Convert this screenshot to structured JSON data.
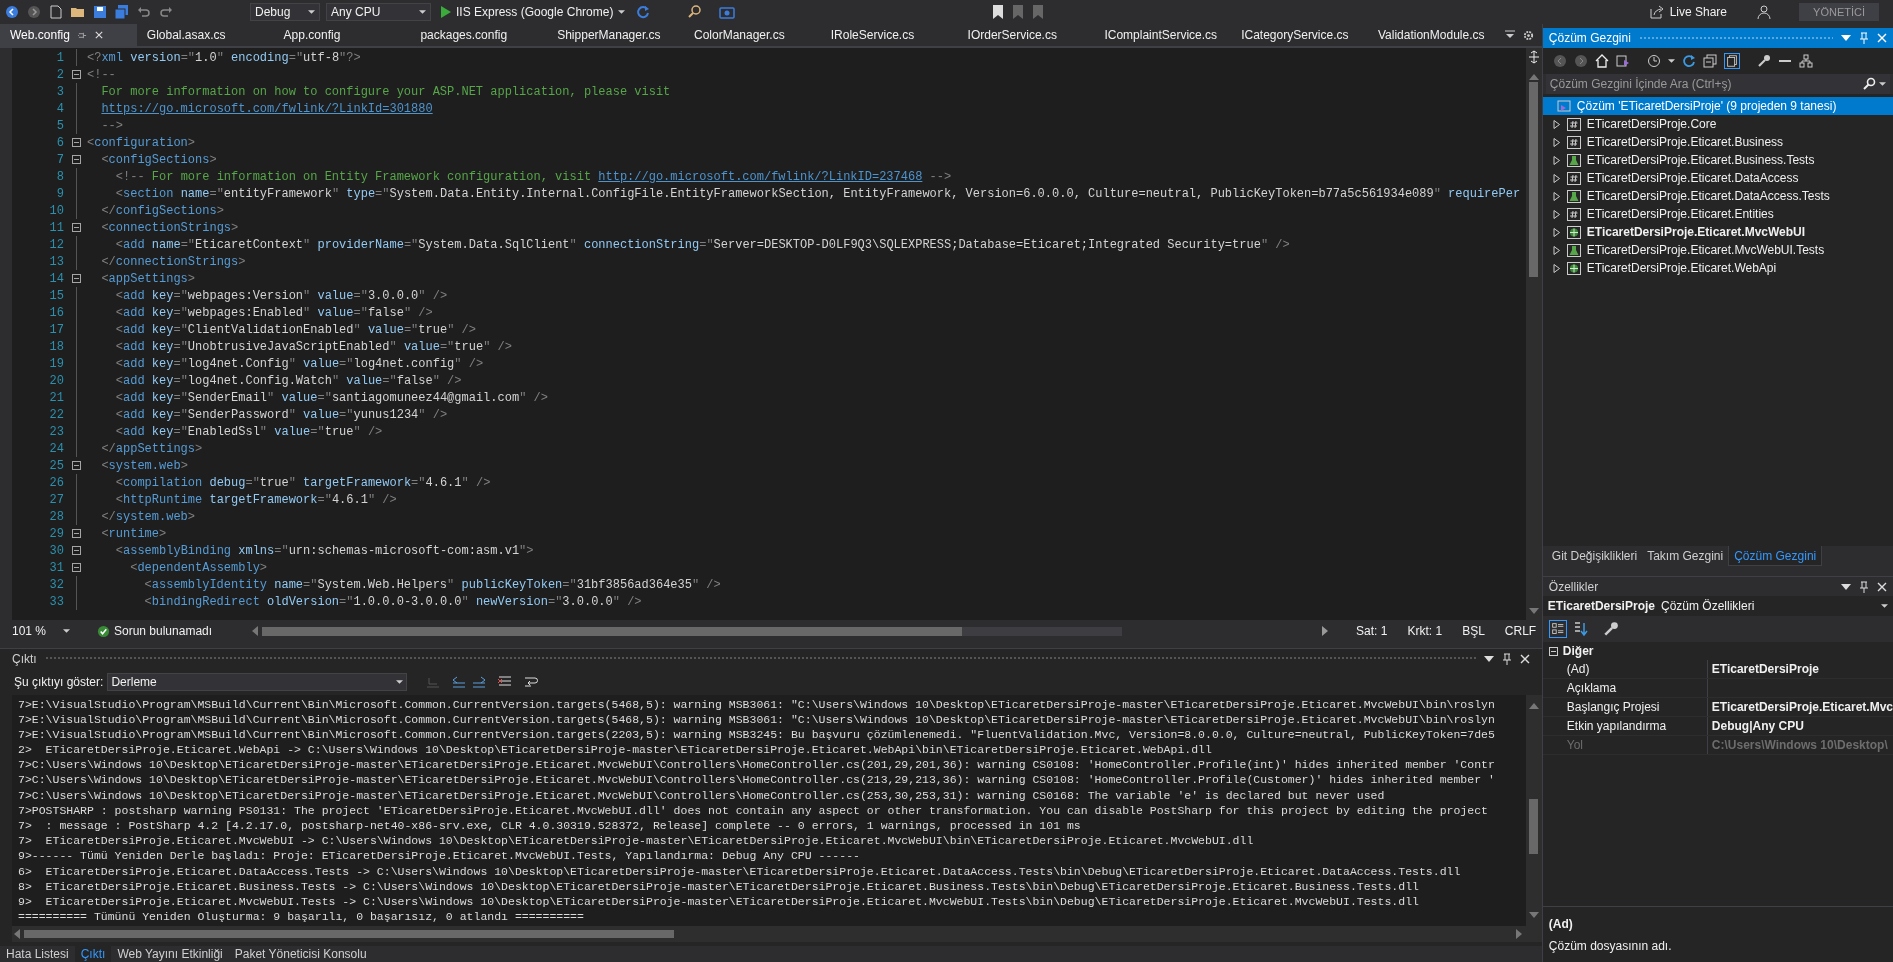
{
  "toolbar": {
    "configuration": "Debug",
    "platform": "Any CPU",
    "run_target": "IIS Express (Google Chrome)",
    "live_share": "Live Share",
    "user_badge": "YÖNETİCİ"
  },
  "tabs": [
    {
      "label": "Web.config",
      "selected": true
    },
    {
      "label": "Global.asax.cs",
      "selected": false
    },
    {
      "label": "App.config",
      "selected": false
    },
    {
      "label": "packages.config",
      "selected": false
    },
    {
      "label": "ShipperManager.cs",
      "selected": false
    },
    {
      "label": "ColorManager.cs",
      "selected": false
    },
    {
      "label": "IRoleService.cs",
      "selected": false
    },
    {
      "label": "IOrderService.cs",
      "selected": false
    },
    {
      "label": "IComplaintService.cs",
      "selected": false
    },
    {
      "label": "ICategoryService.cs",
      "selected": false
    },
    {
      "label": "ValidationModule.cs",
      "selected": false
    }
  ],
  "editor": {
    "lines": [
      {
        "number": "1",
        "text": "<?xml version=\"1.0\" encoding=\"utf-8\"?>",
        "fold": false
      },
      {
        "number": "2",
        "text": "<!--",
        "fold": true
      },
      {
        "number": "3",
        "text": "  For more information on how to configure your ASP.NET application, please visit",
        "fold": false
      },
      {
        "number": "4",
        "text": "  https://go.microsoft.com/fwlink/?LinkId=301880",
        "fold": false
      },
      {
        "number": "5",
        "text": "  -->",
        "fold": false
      },
      {
        "number": "6",
        "text": "<configuration>",
        "fold": true
      },
      {
        "number": "7",
        "text": "  <configSections>",
        "fold": true
      },
      {
        "number": "8",
        "text": "    <!-- For more information on Entity Framework configuration, visit http://go.microsoft.com/fwlink/?LinkID=237468 -->",
        "fold": false
      },
      {
        "number": "9",
        "text": "    <section name=\"entityFramework\" type=\"System.Data.Entity.Internal.ConfigFile.EntityFrameworkSection, EntityFramework, Version=6.0.0.0, Culture=neutral, PublicKeyToken=b77a5c561934e089\" requirePer",
        "fold": false
      },
      {
        "number": "10",
        "text": "  </configSections>",
        "fold": false
      },
      {
        "number": "11",
        "text": "  <connectionStrings>",
        "fold": true
      },
      {
        "number": "12",
        "text": "    <add name=\"EticaretContext\" providerName=\"System.Data.SqlClient\" connectionString=\"Server=DESKTOP-D0LF9Q3\\SQLEXPRESS;Database=Eticaret;Integrated Security=true\" />",
        "fold": false
      },
      {
        "number": "13",
        "text": "  </connectionStrings>",
        "fold": false
      },
      {
        "number": "14",
        "text": "  <appSettings>",
        "fold": true
      },
      {
        "number": "15",
        "text": "    <add key=\"webpages:Version\" value=\"3.0.0.0\" />",
        "fold": false
      },
      {
        "number": "16",
        "text": "    <add key=\"webpages:Enabled\" value=\"false\" />",
        "fold": false
      },
      {
        "number": "17",
        "text": "    <add key=\"ClientValidationEnabled\" value=\"true\" />",
        "fold": false
      },
      {
        "number": "18",
        "text": "    <add key=\"UnobtrusiveJavaScriptEnabled\" value=\"true\" />",
        "fold": false
      },
      {
        "number": "19",
        "text": "    <add key=\"log4net.Config\" value=\"log4net.config\" />",
        "fold": false
      },
      {
        "number": "20",
        "text": "    <add key=\"log4net.Config.Watch\" value=\"false\" />",
        "fold": false
      },
      {
        "number": "21",
        "text": "    <add key=\"SenderEmail\" value=\"santiagomuneez44@gmail.com\" />",
        "fold": false
      },
      {
        "number": "22",
        "text": "    <add key=\"SenderPassword\" value=\"yunus1234\" />",
        "fold": false
      },
      {
        "number": "23",
        "text": "    <add key=\"EnabledSsl\" value=\"true\" />",
        "fold": false
      },
      {
        "number": "24",
        "text": "  </appSettings>",
        "fold": false
      },
      {
        "number": "25",
        "text": "  <system.web>",
        "fold": true
      },
      {
        "number": "26",
        "text": "    <compilation debug=\"true\" targetFramework=\"4.6.1\" />",
        "fold": false
      },
      {
        "number": "27",
        "text": "    <httpRuntime targetFramework=\"4.6.1\" />",
        "fold": false
      },
      {
        "number": "28",
        "text": "  </system.web>",
        "fold": false
      },
      {
        "number": "29",
        "text": "  <runtime>",
        "fold": true
      },
      {
        "number": "30",
        "text": "    <assemblyBinding xmlns=\"urn:schemas-microsoft-com:asm.v1\">",
        "fold": true
      },
      {
        "number": "31",
        "text": "      <dependentAssembly>",
        "fold": true
      },
      {
        "number": "32",
        "text": "        <assemblyIdentity name=\"System.Web.Helpers\" publicKeyToken=\"31bf3856ad364e35\" />",
        "fold": false
      },
      {
        "number": "33",
        "text": "        <bindingRedirect oldVersion=\"1.0.0.0-3.0.0.0\" newVersion=\"3.0.0.0\" />",
        "fold": false
      }
    ],
    "zoom": "101 %",
    "issues": "Sorun bulunamadı",
    "line_pos": "Sat: 1",
    "col_pos": "Krkt: 1",
    "insert_mode": "BŞL",
    "line_ending": "CRLF"
  },
  "output": {
    "title": "Çıktı",
    "show_label": "Şu çıktıyı göster:",
    "source": "Derleme",
    "lines": [
      "7>E:\\VisualStudio\\Program\\MSBuild\\Current\\Bin\\Microsoft.Common.CurrentVersion.targets(5468,5): warning MSB3061: \"C:\\Users\\Windows 10\\Desktop\\ETicaretDersiProje-master\\ETicaretDersiProje.Eticaret.MvcWebUI\\bin\\roslyn",
      "7>E:\\VisualStudio\\Program\\MSBuild\\Current\\Bin\\Microsoft.Common.CurrentVersion.targets(5468,5): warning MSB3061: \"C:\\Users\\Windows 10\\Desktop\\ETicaretDersiProje-master\\ETicaretDersiProje.Eticaret.MvcWebUI\\bin\\roslyn",
      "7>E:\\VisualStudio\\Program\\MSBuild\\Current\\Bin\\Microsoft.Common.CurrentVersion.targets(2203,5): warning MSB3245: Bu başvuru çözümlenemedi. \"FluentValidation.Mvc, Version=8.0.0.0, Culture=neutral, PublicKeyToken=7de5",
      "2>  ETicaretDersiProje.Eticaret.WebApi -> C:\\Users\\Windows 10\\Desktop\\ETicaretDersiProje-master\\ETicaretDersiProje.Eticaret.WebApi\\bin\\ETicaretDersiProje.Eticaret.WebApi.dll",
      "7>C:\\Users\\Windows 10\\Desktop\\ETicaretDersiProje-master\\ETicaretDersiProje.Eticaret.MvcWebUI\\Controllers\\HomeController.cs(201,29,201,36): warning CS0108: 'HomeController.Profile(int)' hides inherited member 'Contr",
      "7>C:\\Users\\Windows 10\\Desktop\\ETicaretDersiProje-master\\ETicaretDersiProje.Eticaret.MvcWebUI\\Controllers\\HomeController.cs(213,29,213,36): warning CS0108: 'HomeController.Profile(Customer)' hides inherited member '",
      "7>C:\\Users\\Windows 10\\Desktop\\ETicaretDersiProje-master\\ETicaretDersiProje.Eticaret.MvcWebUI\\Controllers\\HomeController.cs(253,30,253,31): warning CS0168: The variable 'e' is declared but never used",
      "7>POSTSHARP : postsharp warning PS0131: The project 'ETicaretDersiProje.Eticaret.MvcWebUI.dll' does not contain any aspect or other transformation. You can disable PostSharp for this project by editing the project",
      "7>  : message : PostSharp 4.2 [4.2.17.0, postsharp-net40-x86-srv.exe, CLR 4.0.30319.528372, Release] complete -- 0 errors, 1 warnings, processed in 101 ms",
      "7>  ETicaretDersiProje.Eticaret.MvcWebUI -> C:\\Users\\Windows 10\\Desktop\\ETicaretDersiProje-master\\ETicaretDersiProje.Eticaret.MvcWebUI\\bin\\ETicaretDersiProje.Eticaret.MvcWebUI.dll",
      "9>------ Tümü Yeniden Derle başladı: Proje: ETicaretDersiProje.Eticaret.MvcWebUI.Tests, Yapılandırma: Debug Any CPU ------",
      "6>  ETicaretDersiProje.Eticaret.DataAccess.Tests -> C:\\Users\\Windows 10\\Desktop\\ETicaretDersiProje-master\\ETicaretDersiProje.Eticaret.DataAccess.Tests\\bin\\Debug\\ETicaretDersiProje.Eticaret.DataAccess.Tests.dll",
      "8>  ETicaretDersiProje.Eticaret.Business.Tests -> C:\\Users\\Windows 10\\Desktop\\ETicaretDersiProje-master\\ETicaretDersiProje.Eticaret.Business.Tests\\bin\\Debug\\ETicaretDersiProje.Eticaret.Business.Tests.dll",
      "9>  ETicaretDersiProje.Eticaret.MvcWebUI.Tests -> C:\\Users\\Windows 10\\Desktop\\ETicaretDersiProje-master\\ETicaretDersiProje.Eticaret.MvcWebUI.Tests\\bin\\Debug\\ETicaretDersiProje.Eticaret.MvcWebUI.Tests.dll",
      "========== Tümünü Yeniden Oluşturma: 9 başarılı, 0 başarısız, 0 atlandı =========="
    ]
  },
  "bottom_tabs": [
    {
      "label": "Hata Listesi",
      "selected": false
    },
    {
      "label": "Çıktı",
      "selected": true
    },
    {
      "label": "Web Yayını Etkinliği",
      "selected": false
    },
    {
      "label": "Paket Yöneticisi Konsolu",
      "selected": false
    }
  ],
  "solution_explorer": {
    "title": "Çözüm Gezgini",
    "search_placeholder": "Çözüm Gezgini İçinde Ara (Ctrl+ş)",
    "root": {
      "label": "Çözüm 'ETicaretDersiProje' (9 projeden 9 tanesi)",
      "selected": true
    },
    "projects": [
      {
        "label": "ETicaretDersiProje.Core",
        "kind": "csharp",
        "bold": false,
        "expanded": false,
        "selected": false
      },
      {
        "label": "ETicaretDersiProje.Eticaret.Business",
        "kind": "csharp",
        "bold": false,
        "expanded": false,
        "selected": false
      },
      {
        "label": "ETicaretDersiProje.Eticaret.Business.Tests",
        "kind": "test",
        "bold": false,
        "expanded": false,
        "selected": false
      },
      {
        "label": "ETicaretDersiProje.Eticaret.DataAccess",
        "kind": "csharp",
        "bold": false,
        "expanded": false,
        "selected": false
      },
      {
        "label": "ETicaretDersiProje.Eticaret.DataAccess.Tests",
        "kind": "test",
        "bold": false,
        "expanded": false,
        "selected": false
      },
      {
        "label": "ETicaretDersiProje.Eticaret.Entities",
        "kind": "csharp",
        "bold": false,
        "expanded": false,
        "selected": false
      },
      {
        "label": "ETicaretDersiProje.Eticaret.MvcWebUI",
        "kind": "web",
        "bold": true,
        "expanded": false,
        "selected": false
      },
      {
        "label": "ETicaretDersiProje.Eticaret.MvcWebUI.Tests",
        "kind": "test",
        "bold": false,
        "expanded": false,
        "selected": false
      },
      {
        "label": "ETicaretDersiProje.Eticaret.WebApi",
        "kind": "web",
        "bold": false,
        "expanded": false,
        "selected": false
      }
    ]
  },
  "right_tabs": [
    {
      "label": "Git Değişiklikleri",
      "selected": false
    },
    {
      "label": "Takım Gezgini",
      "selected": false
    },
    {
      "label": "Çözüm Gezgini",
      "selected": true
    }
  ],
  "properties": {
    "title": "Özellikler",
    "object_name": "ETicaretDersiProje",
    "object_type": "Çözüm Özellikleri",
    "category": "Diğer",
    "rows": [
      {
        "name": "(Ad)",
        "value": "ETicaretDersiProje",
        "disabled": false
      },
      {
        "name": "Açıklama",
        "disabled": false
      },
      {
        "name": "Başlangıç Projesi",
        "value": "ETicaretDersiProje.Eticaret.Mvc",
        "disabled": false
      },
      {
        "name": "Etkin yapılandırma",
        "value": "Debug|Any CPU",
        "disabled": false
      },
      {
        "name": "Yol",
        "value": "C:\\Users\\Windows 10\\Desktop\\",
        "disabled": true
      }
    ],
    "description_title": "(Ad)",
    "description": "Çözüm dosyasının adı."
  }
}
